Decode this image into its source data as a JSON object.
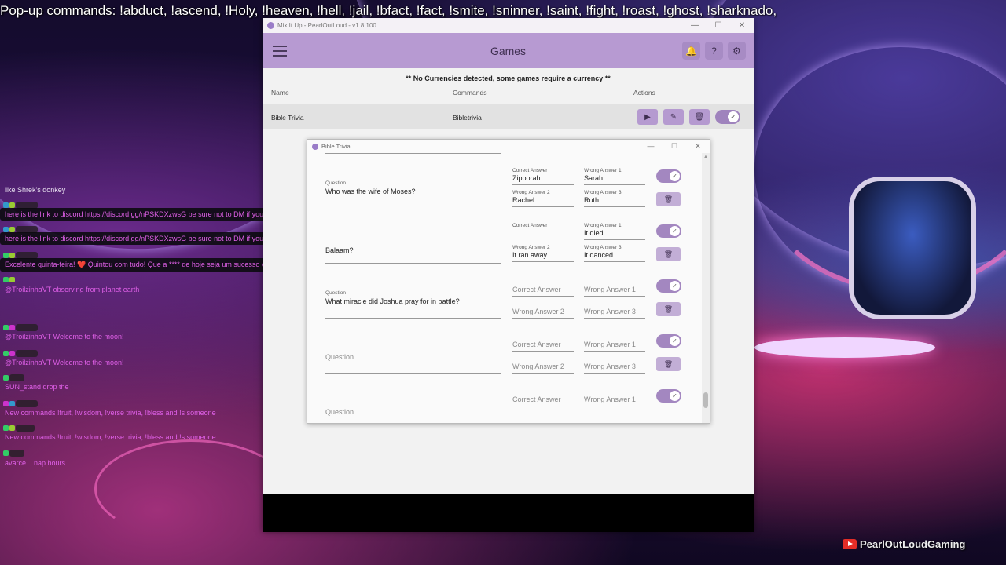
{
  "stream": {
    "ticker": "Pop-up commands: !abduct, !ascend, !Holy, !heaven, !hell,  !jail, !bfact, !fact, !smite, !sninner, !saint, !fight, !roast, !ghost, !sharknado,",
    "watermark": "PearlOutLoudGaming"
  },
  "chat": {
    "messages": [
      "like Shrek's donkey",
      "here is the link to discord https://discord.gg/nPSKDXzwsG be sure not to DM if you can't gain access to the server verify you have read the rules. If you can't I will fix it",
      "here is the link to discord https://discord.gg/nPSKDXzwsG be sure not to DM if you can't gain access to the server verify you have read the rules. If you can't I will fix it",
      "Excelente quinta-feira! ❤️ Quintou com tudo! Que a **** de hoje seja um sucesso e traga muitas alegrias! 🔥 💙",
      "@TroilzinhaVT observing from planet earth",
      "@TroilzinhaVT Welcome to the moon!",
      "@TroilzinhaVT Welcome to the moon!",
      "SUN_stand drop the",
      "New commands !fruit, !wisdom, !verse trivia, !bless and !s someone",
      "New commands !fruit, !wisdom, !verse trivia, !bless and !s someone",
      "avarce... nap hours"
    ]
  },
  "app": {
    "window_title": "Mix It Up - PearlOutLoud - v1.8.100",
    "page_title": "Games",
    "notice": "** No Currencies detected, some games require a currency **",
    "columns": {
      "name": "Name",
      "commands": "Commands",
      "actions": "Actions"
    },
    "games": [
      {
        "name": "Bible Trivia",
        "command": "Bibletrivia",
        "enabled": true
      }
    ]
  },
  "dialog": {
    "title": "Bible Trivia",
    "labels": {
      "question": "Question",
      "correct": "Correct Answer",
      "wrong1": "Wrong Answer 1",
      "wrong2": "Wrong Answer 2",
      "wrong3": "Wrong Answer 3"
    },
    "questions": [
      {
        "question": "Who was the wife of Moses?",
        "correct": "Zipporah",
        "wrong1": "Sarah",
        "wrong2": "Rachel",
        "wrong3": "Ruth",
        "enabled": true
      },
      {
        "question": "Balaam?",
        "correct": "",
        "wrong1": "It died",
        "wrong2": "It ran away",
        "wrong3": "It danced",
        "enabled": true
      },
      {
        "question": "What miracle did Joshua pray for in battle?",
        "correct": "",
        "wrong1": "",
        "wrong2": "",
        "wrong3": "",
        "enabled": true
      },
      {
        "question": "",
        "correct": "",
        "wrong1": "",
        "wrong2": "",
        "wrong3": "",
        "enabled": true
      },
      {
        "question": "",
        "correct": "",
        "wrong1": "",
        "wrong2": "",
        "wrong3": "",
        "enabled": true
      }
    ]
  },
  "icons": {
    "menu": "hamburger-icon",
    "bell": "bell-icon",
    "help": "help-icon",
    "settings": "gear-icon",
    "play": "play-icon",
    "edit": "edit-icon",
    "delete": "trash-icon",
    "check": "check-icon"
  },
  "colors": {
    "accent": "#b79ad2",
    "accent_dark": "#9f83bd",
    "button": "#b59ad0"
  }
}
